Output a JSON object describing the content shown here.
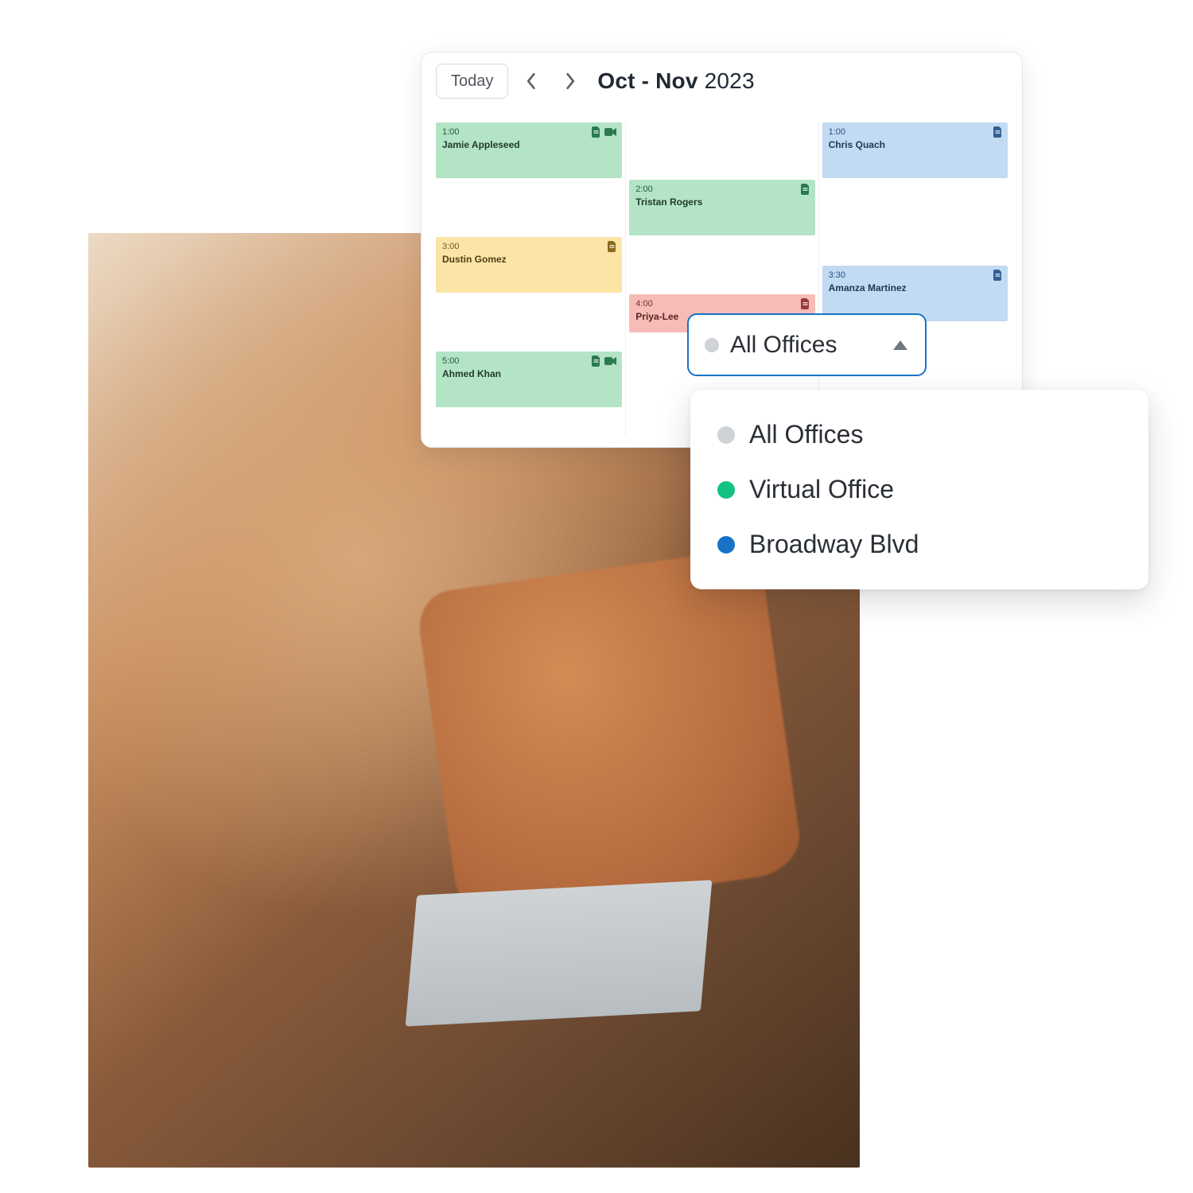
{
  "header": {
    "today_label": "Today",
    "range_bold": "Oct - Nov",
    "range_year": "2023"
  },
  "calendar": {
    "events": [
      {
        "col": 0,
        "row": 0,
        "color": "green",
        "time": "1:00",
        "name": "Jamie Appleseed",
        "has_video": true
      },
      {
        "col": 2,
        "row": 0,
        "color": "blue",
        "time": "1:00",
        "name": "Chris Quach",
        "has_video": false
      },
      {
        "col": 1,
        "row": 1,
        "color": "green",
        "time": "2:00",
        "name": "Tristan Rogers",
        "has_video": false
      },
      {
        "col": 0,
        "row": 2,
        "color": "yellow",
        "time": "3:00",
        "name": "Dustin Gomez",
        "has_video": false
      },
      {
        "col": 2,
        "row": 2.5,
        "color": "blue",
        "time": "3:30",
        "name": "Amanza Martinez",
        "has_video": false
      },
      {
        "col": 1,
        "row": 3,
        "color": "red",
        "time": "4:00",
        "name": "Priya-Lee",
        "has_video": false,
        "short": true
      },
      {
        "col": 0,
        "row": 4,
        "color": "green",
        "time": "5:00",
        "name": "Ahmed Khan",
        "has_video": true
      }
    ]
  },
  "filter": {
    "selected": {
      "label": "All Offices",
      "dot": "gray"
    },
    "options": [
      {
        "label": "All Offices",
        "dot": "gray"
      },
      {
        "label": "Virtual Office",
        "dot": "green"
      },
      {
        "label": "Broadway Blvd",
        "dot": "blue"
      }
    ]
  },
  "colors": {
    "select_border": "#1773c8",
    "event_green": "#b3e4c5",
    "event_blue": "#c2daf2",
    "event_yellow": "#fbe4a5",
    "event_red": "#f6bcb8"
  }
}
